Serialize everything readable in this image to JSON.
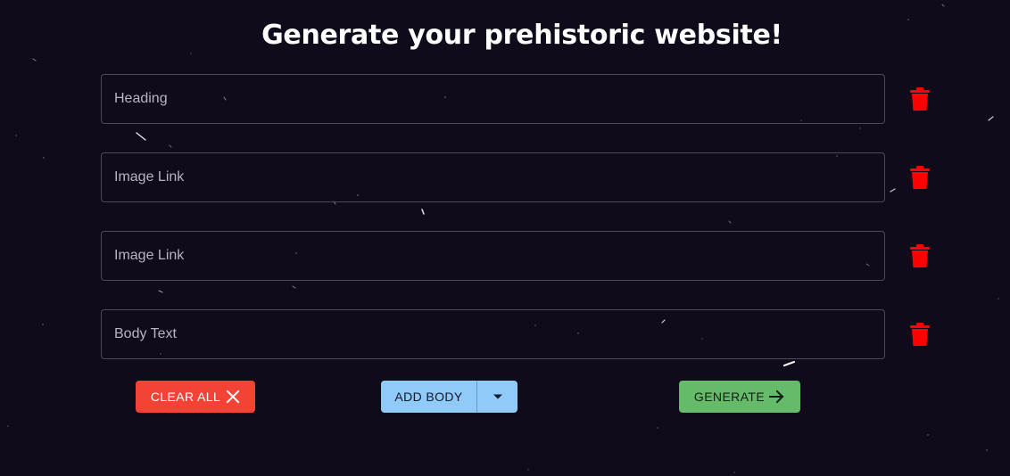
{
  "page": {
    "title": "Generate your prehistoric website!"
  },
  "fields": [
    {
      "placeholder": "Heading",
      "value": "",
      "kind": "heading"
    },
    {
      "placeholder": "Image Link",
      "value": "",
      "kind": "image"
    },
    {
      "placeholder": "Image Link",
      "value": "",
      "kind": "image"
    },
    {
      "placeholder": "Body Text",
      "value": "",
      "kind": "body"
    }
  ],
  "icons": {
    "delete": "trash-icon",
    "clear": "close-icon",
    "dropdown": "caret-down-icon",
    "generate": "arrow-right-icon"
  },
  "actions": {
    "clear_label": "CLEAR ALL",
    "add_body_label": "ADD BODY",
    "generate_label": "GENERATE"
  },
  "colors": {
    "background": "#100b1b",
    "delete": "#ff0000",
    "clear": "#f44336",
    "add_body": "#90caf9",
    "generate": "#66bb6a"
  }
}
